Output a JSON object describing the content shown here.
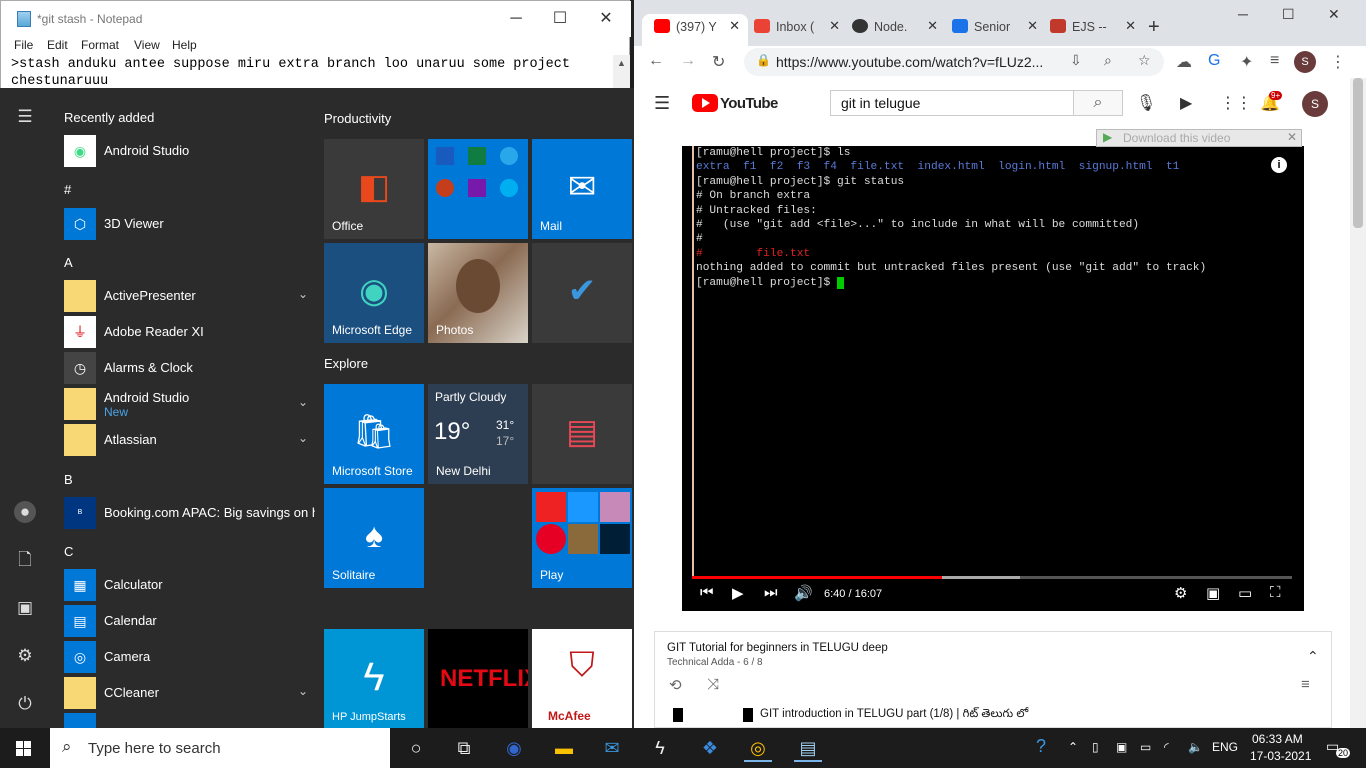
{
  "notepad": {
    "title": "*git stash - Notepad",
    "menu": [
      "File",
      "Edit",
      "Format",
      "View",
      "Help"
    ],
    "text_line1": ">stash anduku antee suppose miru extra branch loo unaruu some project",
    "text_line2": "chestunaruuu"
  },
  "start_menu": {
    "recently_added_header": "Recently added",
    "recent_app": "Android Studio",
    "hash": "#",
    "letter_a": "A",
    "letter_b": "B",
    "letter_c": "C",
    "apps": {
      "viewer3d": "3D Viewer",
      "activepresenter": "ActivePresenter",
      "adobe": "Adobe Reader XI",
      "alarms": "Alarms & Clock",
      "android": "Android Studio",
      "android_badge": "New",
      "atlassian": "Atlassian",
      "booking": "Booking.com APAC: Big savings on h...",
      "calculator": "Calculator",
      "calendar": "Calendar",
      "camera": "Camera",
      "ccleaner": "CCleaner"
    },
    "groups": {
      "productivity": "Productivity",
      "explore": "Explore"
    },
    "tiles": {
      "office": "Office",
      "mail": "Mail",
      "edge": "Microsoft Edge",
      "photos": "Photos",
      "store": "Microsoft Store",
      "weather_cond": "Partly Cloudy",
      "weather_temp": "19°",
      "weather_hi": "31°",
      "weather_lo": "17°",
      "weather_city": "New Delhi",
      "solitaire": "Solitaire",
      "play": "Play",
      "hp": "HP JumpStarts",
      "netflix": "NETFLIX",
      "mcafee": "McAfee"
    }
  },
  "taskbar": {
    "search_placeholder": "Type here to search",
    "language": "ENG",
    "time": "06:33 AM",
    "date": "17-03-2021",
    "notif_count": "20"
  },
  "chrome": {
    "tabs": [
      {
        "title": "(397) Y",
        "color": "#ff0000"
      },
      {
        "title": "Inbox (",
        "color": "#ea4335"
      },
      {
        "title": "Node.",
        "color": "#333333"
      },
      {
        "title": "Senior",
        "color": "#1a73e8"
      },
      {
        "title": "EJS --",
        "color": "#c0392b"
      }
    ],
    "url": "https://www.youtube.com/watch?v=fLUz2...",
    "profile_initial": "S"
  },
  "youtube": {
    "logo": "YouTube",
    "search_value": "git in telugue",
    "notif_badge": "9+",
    "download_banner": "Download this video",
    "terminal": [
      "[ramu@hell project]$ ls",
      "extra  f1  f2  f3  f4  file.txt  index.html  login.html  signup.html  t1",
      "[ramu@hell project]$ git status",
      "# On branch extra",
      "# Untracked files:",
      "#   (use \"git add <file>...\" to include in what will be committed)",
      "#",
      "#        file.txt",
      "nothing added to commit but untracked files present (use \"git add\" to track)",
      "[ramu@hell project]$ "
    ],
    "time_display": "6:40 / 16:07",
    "progress": 0.4163,
    "playlist_title": "GIT Tutorial for beginners in TELUGU deep",
    "playlist_sub": "Technical Adda - 6 / 8",
    "playlist_item": "GIT introduction in TELUGU part (1/8) | గిట్ తెలుగు లో"
  }
}
